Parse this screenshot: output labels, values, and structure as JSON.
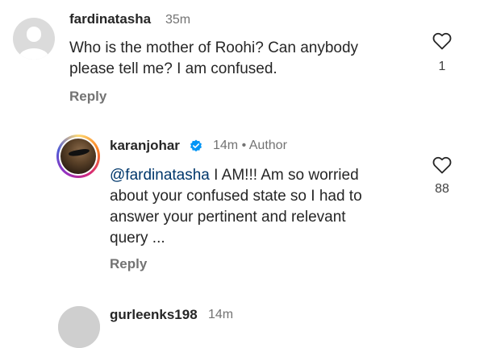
{
  "comments": [
    {
      "username": "fardinatasha",
      "time": "35m",
      "text": "Who is the mother of Roohi? Can anybody please tell me? I am confused.",
      "line1": "Who is the mother of Roohi? Can anybody",
      "line2": "please tell me? I am confused.",
      "likes": "1",
      "reply_label": "Reply"
    },
    {
      "username": "karanjohar",
      "verified": true,
      "time": "14m",
      "separator": "•",
      "author_badge": "Author",
      "mention": "@fardinatasha",
      "text_after_mention": " I AM!!! Am so worried",
      "line2": "about your confused state so I had to",
      "line3": "answer your pertinent and relevant",
      "line4": "query ...",
      "likes": "88",
      "reply_label": "Reply"
    },
    {
      "username": "gurleenks198",
      "time": "14m"
    }
  ],
  "colors": {
    "text": "#262626",
    "secondary": "#737373",
    "mention": "#00376b",
    "verified": "#0095f6",
    "avatar_placeholder": "#dbdbdb"
  },
  "icons": {
    "like": "heart-outline-icon",
    "verified": "verified-badge-icon"
  }
}
